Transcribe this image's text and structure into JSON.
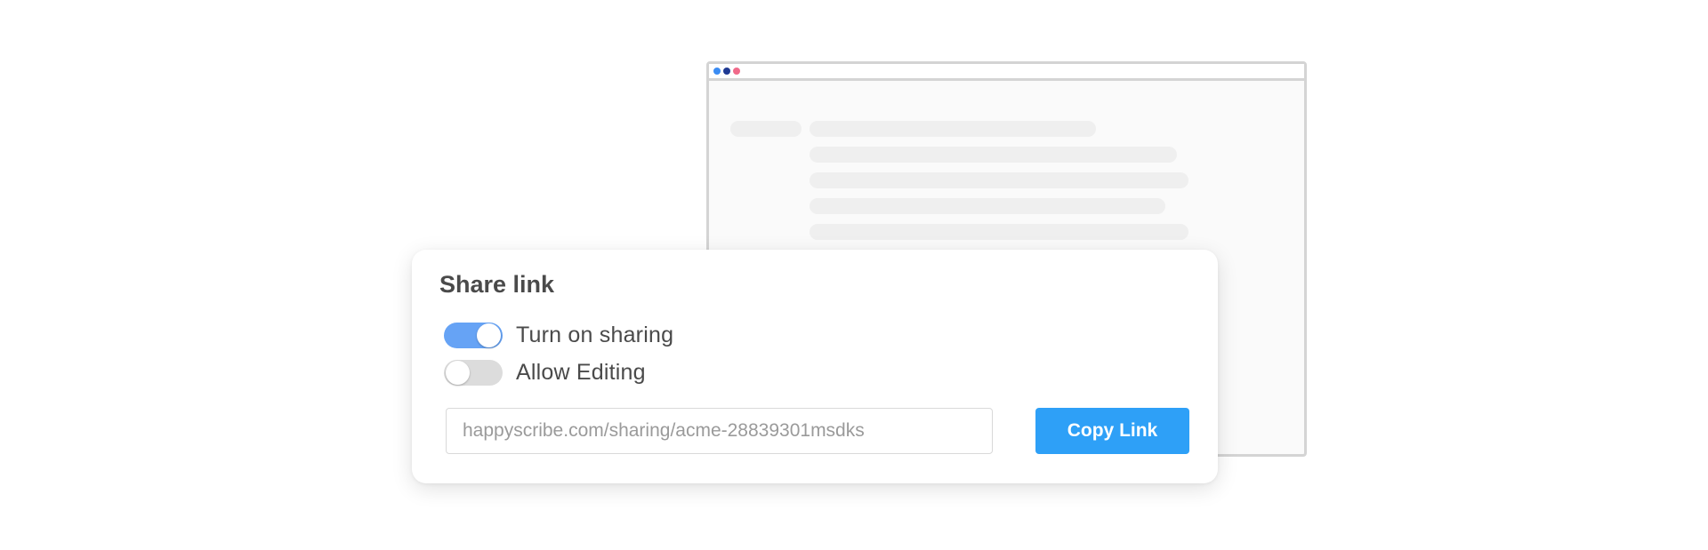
{
  "browser_mock": {
    "dots": [
      {
        "name": "blue-dot",
        "color": "#3b8cf3"
      },
      {
        "name": "navy-dot",
        "color": "#1f3a93"
      },
      {
        "name": "pink-dot",
        "color": "#f06a8a"
      }
    ]
  },
  "share_card": {
    "title": "Share link",
    "toggles": [
      {
        "label": "Turn on sharing",
        "state": "on"
      },
      {
        "label": "Allow Editing",
        "state": "off"
      }
    ],
    "link_field": {
      "value": "happyscribe.com/sharing/acme-28839301msdks"
    },
    "copy_button_label": "Copy Link"
  },
  "colors": {
    "toggle_on": "#66a3f5",
    "toggle_off": "#dcdcdc",
    "button": "#2ea0f7",
    "text": "#4a4a4a"
  }
}
